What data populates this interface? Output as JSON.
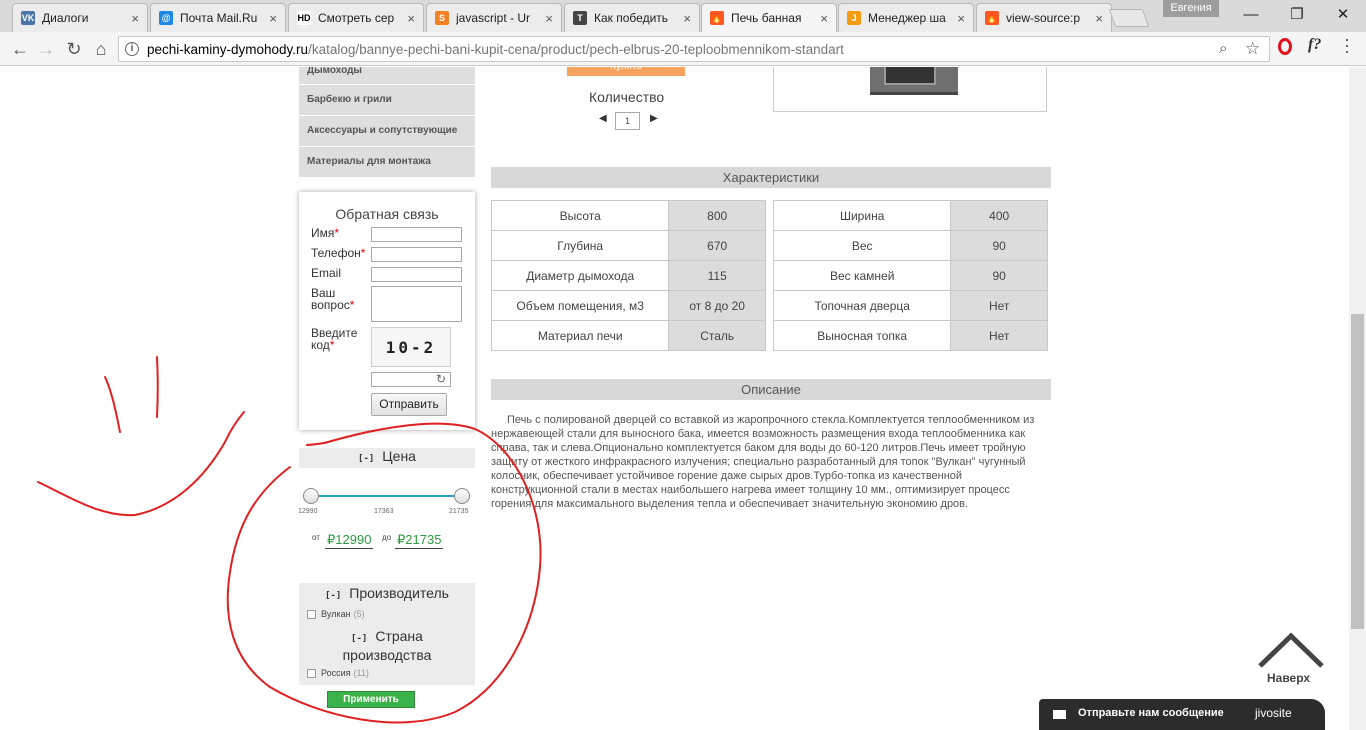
{
  "browser": {
    "tabs": [
      {
        "label": "Диалоги",
        "icon_color": "#4a76a8",
        "icon_glyph": "VK"
      },
      {
        "label": "Почта Mail.Ru",
        "icon_color": "#1e88e5",
        "icon_glyph": "@"
      },
      {
        "label": "Смотреть сер",
        "icon_color": "#ffffff",
        "icon_glyph": "HD"
      },
      {
        "label": "javascript - Ur",
        "icon_color": "#f48024",
        "icon_glyph": "S"
      },
      {
        "label": "Как победить",
        "icon_color": "#444444",
        "icon_glyph": "T"
      },
      {
        "label": "Печь банная",
        "icon_color": "#ff5722",
        "icon_glyph": "🔥"
      },
      {
        "label": "Менеджер ша",
        "icon_color": "#f39c12",
        "icon_glyph": "J"
      },
      {
        "label": "view-source:p",
        "icon_color": "#ff5722",
        "icon_glyph": "🔥"
      }
    ],
    "profile": "Евгения",
    "url_domain": "pechi-kaminy-dymohody.ru",
    "url_path": "/katalog/bannye-pechi-bani-kupit-cena/product/pech-elbrus-20-teploobmennikom-standart"
  },
  "catalog": {
    "items": [
      "Дымоходы",
      "Барбекю и грили",
      "Аксессуары и сопутствующие",
      "Материалы для монтажа"
    ]
  },
  "feedback": {
    "title": "Обратная связь",
    "name_label": "Имя",
    "phone_label": "Телефон",
    "email_label": "Email",
    "question_label_1": "Ваш",
    "question_label_2": "вопрос",
    "code_label_1": "Введите",
    "code_label_2": "код",
    "required_mark": "*",
    "captcha_text": "10-2",
    "submit": "Отправить"
  },
  "price_filter": {
    "toggle": "[-]",
    "title": "Цена",
    "min_tick": "12990",
    "mid_tick": "17363",
    "max_tick": "21735",
    "from_label": "от",
    "to_label": "до",
    "from_value": "₽12990",
    "to_value": "₽21735"
  },
  "manufacturer_filter": {
    "toggle": "[-]",
    "title": "Производитель",
    "option_label": "Вулкан",
    "option_count": "(5)"
  },
  "country_filter": {
    "toggle": "[-]",
    "title_1": "Страна",
    "title_2": "производства",
    "option_label": "Россия",
    "option_count": "(11)"
  },
  "apply_button": "Применить",
  "product": {
    "buy_label": "Купить",
    "qty_label": "Количество",
    "qty_value": "1",
    "qty_prev": "◀",
    "qty_next": "▶"
  },
  "specs": {
    "title": "Характеристики",
    "left": [
      {
        "k": "Высота",
        "v": "800"
      },
      {
        "k": "Глубина",
        "v": "670"
      },
      {
        "k": "Диаметр дымохода",
        "v": "115"
      },
      {
        "k": "Объем помещения, м3",
        "v": "от 8 до 20"
      },
      {
        "k": "Материал печи",
        "v": "Сталь"
      }
    ],
    "right": [
      {
        "k": "Ширина",
        "v": "400"
      },
      {
        "k": "Вес",
        "v": "90"
      },
      {
        "k": "Вес камней",
        "v": "90"
      },
      {
        "k": "Топочная дверца",
        "v": "Нет"
      },
      {
        "k": "Выносная топка",
        "v": "Нет"
      }
    ]
  },
  "description": {
    "title": "Описание",
    "text": "Печь с полированой дверцей со вставкой из жаропрочного стекла.Комплектуется теплообменником из нержавеющей стали для выносного бака, имеется возможность размещения входа теплообменника как справа, так и слева.Опционально комплектуется баком для воды до 60-120 литров.Печь имеет тройную защиту от жесткого инфракрасного излучения; специально разработанный для топок \"Вулкан\" чугунный колосник, обеспечивает устойчивое горение даже сырых дров.Турбо-топка из качественной конструкционной стали в местах наибольшего нагрева имеет толщину 10 мм., оптимизирует процесс горения для максимального выделения тепла и обеспечивает значительную экономию дров."
  },
  "to_top": "Наверх",
  "jivo": {
    "text": "Отправьте нам сообщение",
    "brand": "jivosite"
  },
  "colors": {
    "accent_orange": "#f5a35f",
    "apply_green": "#3cb34a",
    "price_green": "#2c9a3f",
    "slider_blue": "#29a0c4",
    "scribble_red": "#e02020"
  }
}
